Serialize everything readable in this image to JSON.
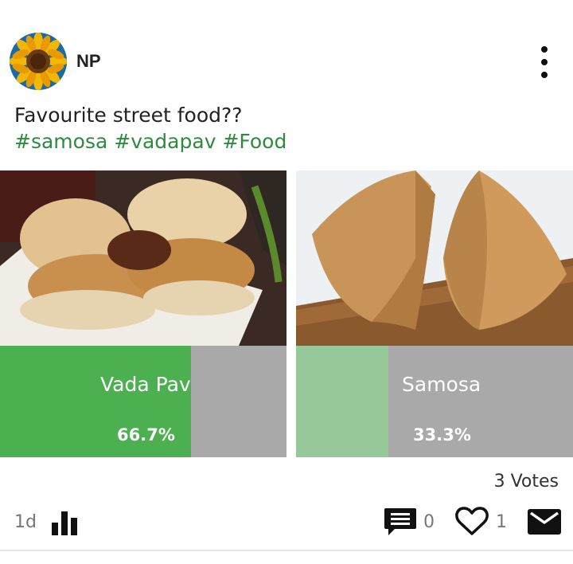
{
  "post": {
    "username": "NP",
    "question": "Favourite street food??",
    "hashtags": [
      "#samosa",
      "#vadapav",
      "#Food"
    ]
  },
  "poll": {
    "options": [
      {
        "label": "Vada Pav",
        "percent_text": "66.7%",
        "percent": 66.7,
        "image": "vada-pav-photo",
        "fill_color": "#4caf50"
      },
      {
        "label": "Samosa",
        "percent_text": "33.3%",
        "percent": 33.3,
        "image": "samosa-photo",
        "fill_color": "#96c89a"
      }
    ],
    "remainder_color": "#a9a9a9"
  },
  "footer": {
    "votes": "3 Votes",
    "age": "1d",
    "comment_count": "0",
    "like_count": "1"
  },
  "icons": {
    "avatar": "sunflower-avatar",
    "more": "more-vertical-icon",
    "stats": "bar-chart-icon",
    "comment": "comment-icon",
    "like": "heart-icon",
    "share": "mail-icon"
  },
  "colors": {
    "hashtag": "#2e8b3e",
    "primary_fill": "#4caf50",
    "secondary_fill": "#96c89a"
  }
}
